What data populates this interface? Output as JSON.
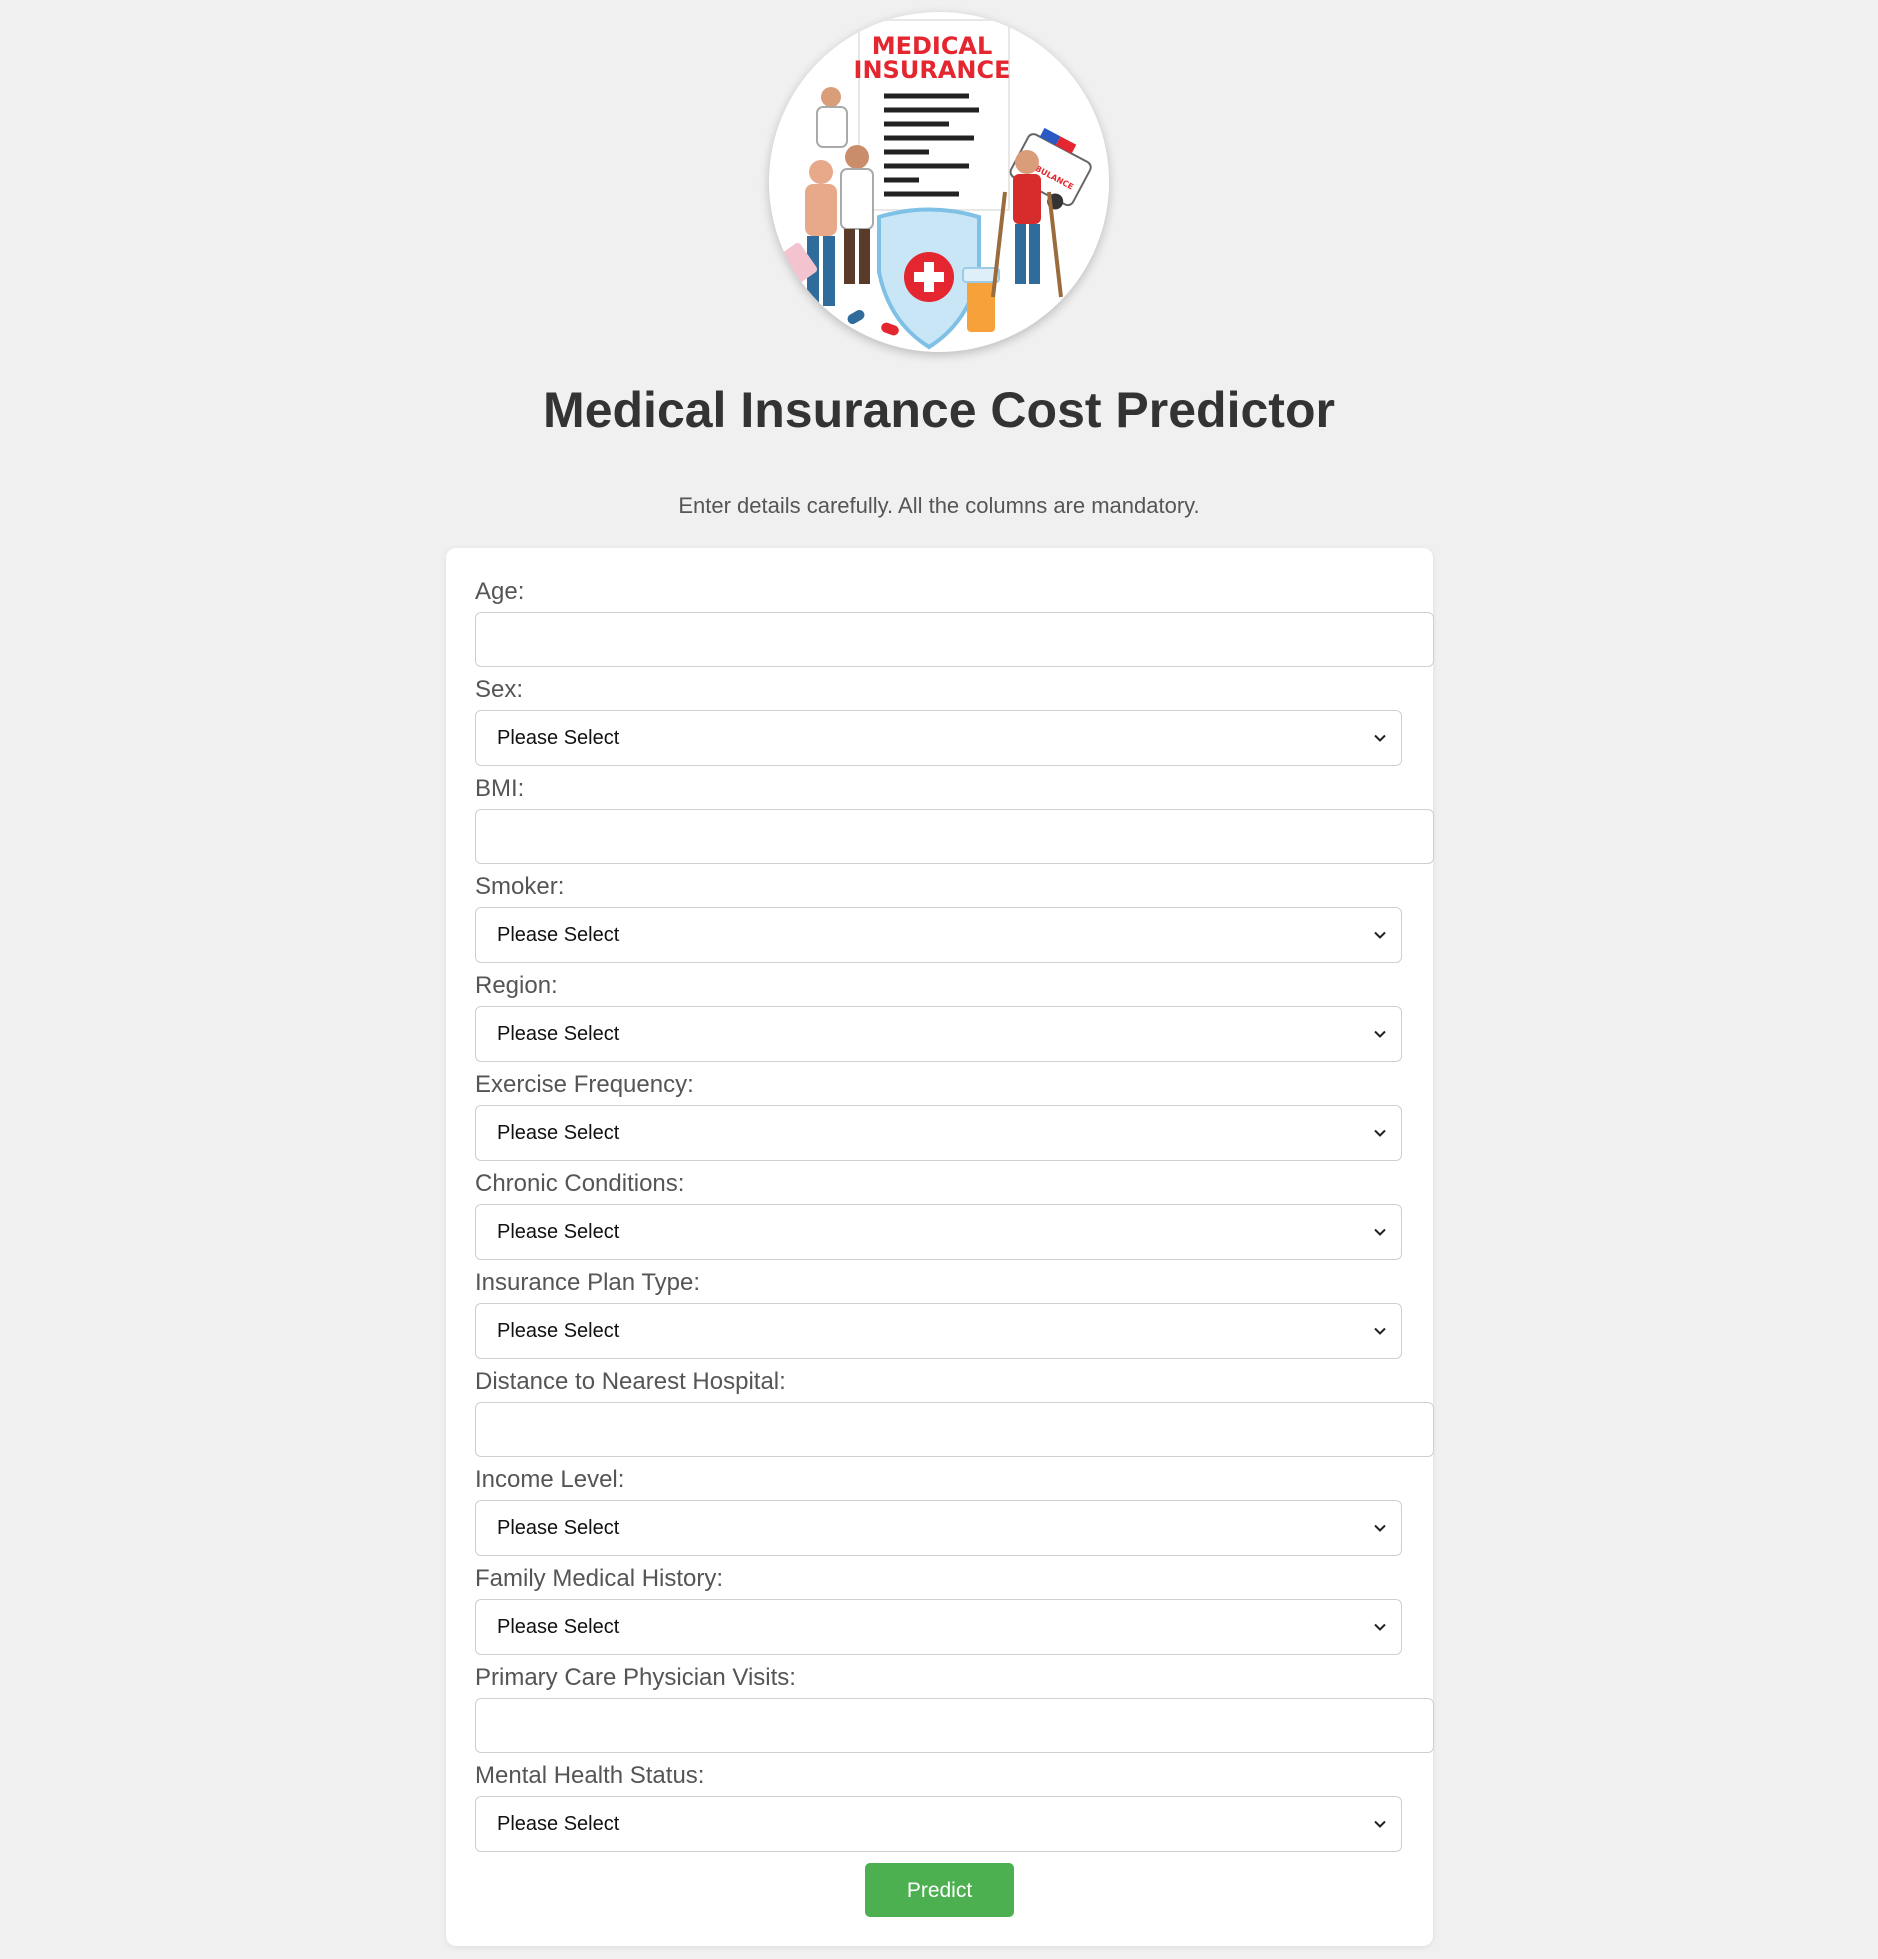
{
  "logo": {
    "line1": "MEDICAL",
    "line2": "INSURANCE",
    "ambulance_text": "AMBULANCE",
    "icon": "medical-insurance-illustration"
  },
  "page": {
    "title": "Medical Insurance Cost Predictor",
    "subtitle": "Enter details carefully. All the columns are mandatory."
  },
  "form": {
    "fields": [
      {
        "label": "Age:",
        "type": "input",
        "value": "",
        "placeholder": ""
      },
      {
        "label": "Sex:",
        "type": "select",
        "value": "Please Select"
      },
      {
        "label": "BMI:",
        "type": "input",
        "value": "",
        "placeholder": ""
      },
      {
        "label": "Smoker:",
        "type": "select",
        "value": "Please Select"
      },
      {
        "label": "Region:",
        "type": "select",
        "value": "Please Select"
      },
      {
        "label": "Exercise Frequency:",
        "type": "select",
        "value": "Please Select"
      },
      {
        "label": "Chronic Conditions:",
        "type": "select",
        "value": "Please Select"
      },
      {
        "label": "Insurance Plan Type:",
        "type": "select",
        "value": "Please Select"
      },
      {
        "label": "Distance to Nearest Hospital:",
        "type": "input",
        "value": "",
        "placeholder": ""
      },
      {
        "label": "Income Level:",
        "type": "select",
        "value": "Please Select"
      },
      {
        "label": "Family Medical History:",
        "type": "select",
        "value": "Please Select"
      },
      {
        "label": "Primary Care Physician Visits:",
        "type": "input",
        "value": "",
        "placeholder": ""
      },
      {
        "label": "Mental Health Status:",
        "type": "select",
        "value": "Please Select"
      }
    ],
    "submit_label": "Predict"
  },
  "colors": {
    "background": "#f0f0f0",
    "card": "#ffffff",
    "button": "#4caf50",
    "button_text": "#ffffff",
    "title": "#333333",
    "label": "#555555",
    "logo_red": "#e3262f",
    "shield_blue": "#c9e6f7"
  }
}
